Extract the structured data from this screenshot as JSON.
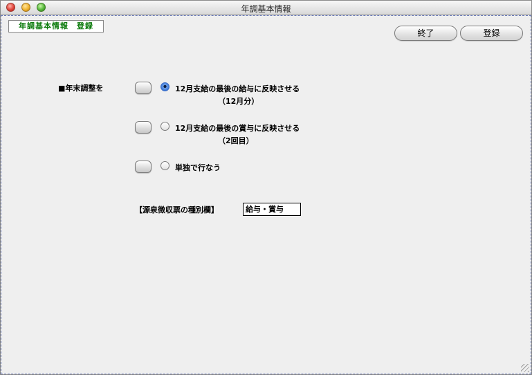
{
  "window": {
    "title": "年調基本情報"
  },
  "form": {
    "label": "年調基本情報　登録"
  },
  "toolbar": {
    "exit_label": "終了",
    "register_label": "登録"
  },
  "section": {
    "label": "■年末調整を",
    "options": [
      {
        "text": "12月支給の最後の給与に反映させる",
        "sub": "（12月分）",
        "selected": true
      },
      {
        "text": "12月支給の最後の賞与に反映させる",
        "sub": "（2回目）",
        "selected": false
      },
      {
        "text": "単独で行なう",
        "sub": "",
        "selected": false
      }
    ]
  },
  "withholding": {
    "label": "【源泉徴収票の種別欄】",
    "value": "給与・賞与"
  },
  "colors": {
    "form_label_text": "#0a7a0a",
    "radio_selected": "#3b78d8"
  }
}
